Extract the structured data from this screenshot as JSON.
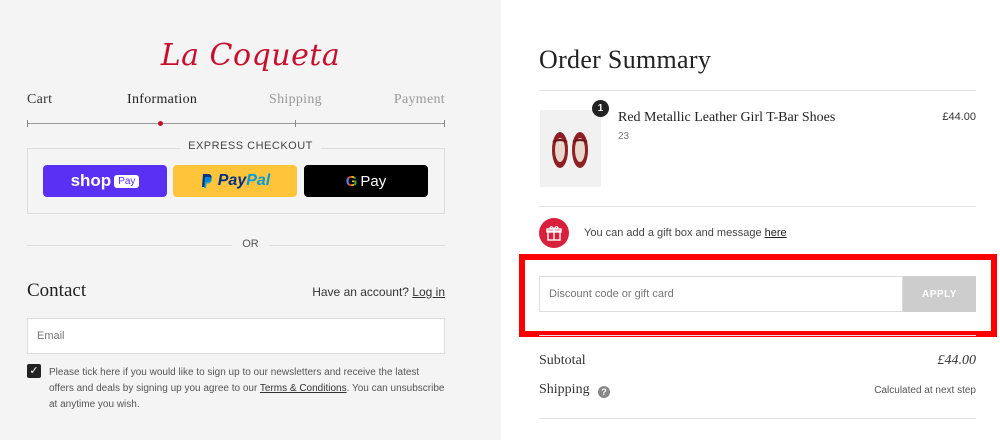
{
  "brand": {
    "logo_text": "La Coqueta",
    "accent_color": "#c8102e"
  },
  "breadcrumb": {
    "steps": [
      {
        "label": "Cart",
        "state": "done"
      },
      {
        "label": "Information",
        "state": "current"
      },
      {
        "label": "Shipping",
        "state": "upcoming"
      },
      {
        "label": "Payment",
        "state": "upcoming"
      }
    ]
  },
  "express_checkout": {
    "label": "EXPRESS CHECKOUT",
    "shop_pay": {
      "text": "shop",
      "tag": "Pay",
      "color": "#5a31f4"
    },
    "paypal": {
      "part1": "Pay",
      "part2": "Pal",
      "color": "#ffc439"
    },
    "google_pay": {
      "g": "G",
      "text": "Pay",
      "color": "#000000"
    }
  },
  "divider": {
    "or_label": "OR"
  },
  "contact": {
    "title": "Contact",
    "have_account": "Have an account?",
    "login_link": "Log in",
    "email_placeholder": "Email",
    "newsletter_checked": true,
    "newsletter_text_1": "Please tick here if you would like to sign up to our newsletters and receive the latest offers and deals by signing up you agree to our ",
    "terms_link": "Terms & Conditions",
    "newsletter_text_2": ". You can unsubscribe at anytime you wish."
  },
  "order_summary": {
    "title": "Order Summary",
    "items": [
      {
        "quantity": "1",
        "name": "Red Metallic Leather Girl T-Bar Shoes",
        "variant": "23",
        "price": "£44.00",
        "image_icon": "red-shoes-image"
      }
    ],
    "gift": {
      "text": "You can add a gift box and message ",
      "link": "here",
      "icon": "gift-icon",
      "color": "#d81f3c"
    },
    "discount": {
      "placeholder": "Discount code or gift card",
      "apply_label": "APPLY"
    },
    "subtotal": {
      "label": "Subtotal",
      "value": "£44.00"
    },
    "shipping": {
      "label": "Shipping",
      "value": "Calculated at next step"
    }
  }
}
